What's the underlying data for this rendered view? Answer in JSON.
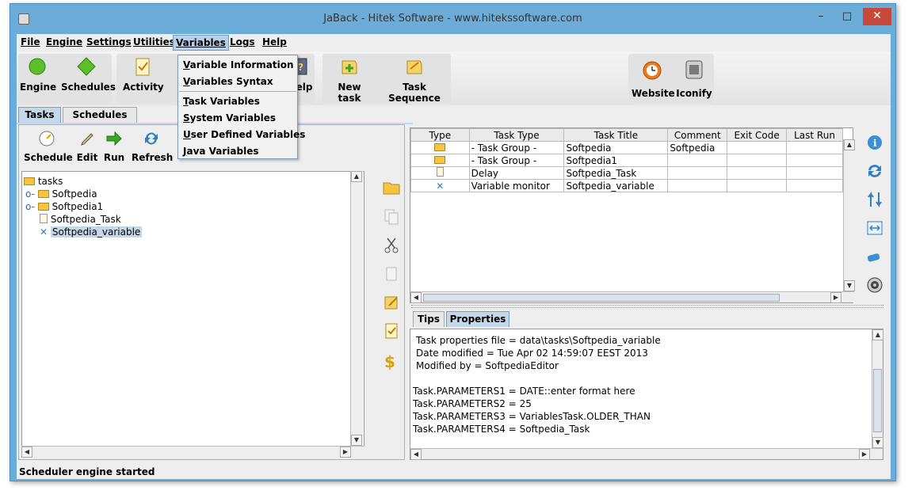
{
  "window": {
    "title": "JaBack     - Hitek Software - www.hitekssoftware.com",
    "minimize": "–",
    "maximize": "□",
    "close": "✕"
  },
  "menu": [
    "File",
    "Engine",
    "Settings",
    "Utilities",
    "Variables",
    "Logs",
    "Help"
  ],
  "variables_menu": [
    "Variable Information",
    "Variables Syntax",
    "Task Variables",
    "System Variables",
    "User Defined Variables",
    "Java Variables"
  ],
  "toolbar": {
    "engine": "Engine",
    "schedules": "Schedules",
    "activity": "Activity",
    "help": "Help",
    "new_task": "New task",
    "task_sequence": "Task Sequence",
    "website": "Website",
    "iconify": "Iconify"
  },
  "main_tabs": [
    "Tasks",
    "Schedules"
  ],
  "task_actions": [
    "Schedule",
    "Edit",
    "Run",
    "Refresh"
  ],
  "tree": {
    "root": "tasks",
    "items": [
      "Softpedia",
      "Softpedia1",
      "Softpedia_Task",
      "Softpedia_variable"
    ]
  },
  "table": {
    "headers": [
      "Type",
      "Task Type",
      "Task Title",
      "Comment",
      "Exit Code",
      "Last Run"
    ],
    "rows": [
      {
        "type_icon": "folder-icon",
        "task_type": "- Task Group -",
        "title": "Softpedia",
        "comment": "Softpedia"
      },
      {
        "type_icon": "folder-icon",
        "task_type": "- Task Group -",
        "title": "Softpedia1",
        "comment": ""
      },
      {
        "type_icon": "document-icon",
        "task_type": "Delay",
        "title": "Softpedia_Task",
        "comment": ""
      },
      {
        "type_icon": "variable-icon",
        "task_type": "Variable monitor",
        "title": "Softpedia_variable",
        "comment": ""
      }
    ]
  },
  "detail_tabs": [
    "Tips",
    "Properties"
  ],
  "properties": {
    "lines": [
      "Task properties file = data\\tasks\\Softpedia_variable",
      "Date modified = Tue Apr 02 14:59:07 EEST 2013",
      "Modified by = SoftpediaEditor",
      "",
      "Task.PARAMETERS1 = DATE::enter format here",
      "Task.PARAMETERS2 = 25",
      "Task.PARAMETERS3 = VariablesTask.OLDER_THAN",
      "Task.PARAMETERS4 = Softpedia_Task"
    ]
  },
  "status": "Scheduler engine started",
  "colors": {
    "accent": "#6badd8",
    "close": "#c7493c",
    "folder": "#f4c542"
  }
}
